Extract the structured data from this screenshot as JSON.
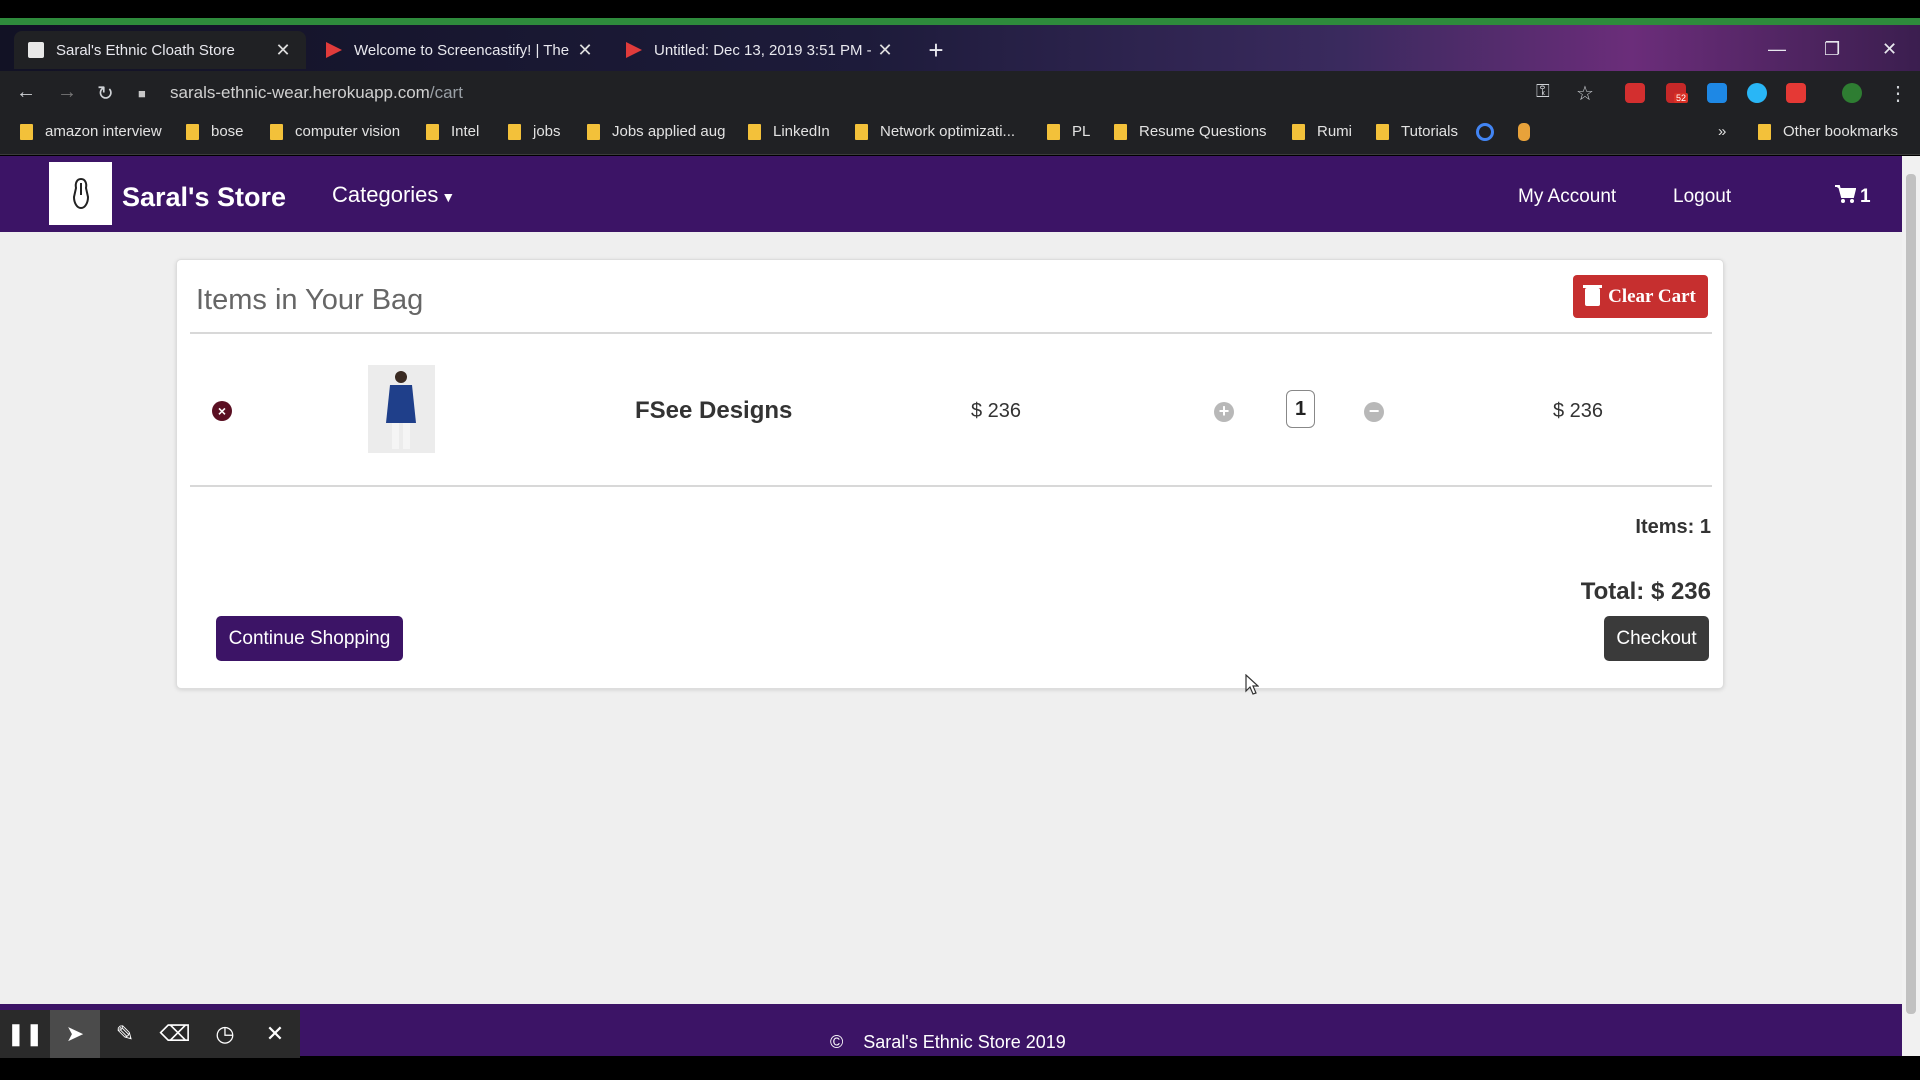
{
  "browser": {
    "tabs": [
      {
        "title": "Saral's Ethnic Cloath Store",
        "active": true
      },
      {
        "title": "Welcome to Screencastify! | The",
        "active": false
      },
      {
        "title": "Untitled: Dec 13, 2019 3:51 PM -",
        "active": false
      }
    ],
    "url_host": "sarals-ethnic-wear.herokuapp.com",
    "url_path": "/cart",
    "ext_badge": "52",
    "bookmarks": [
      "amazon interview",
      "bose",
      "computer vision",
      "Intel",
      "jobs",
      "Jobs applied aug",
      "LinkedIn",
      "Network optimizati...",
      "PL",
      "Resume Questions",
      "Rumi",
      "Tutorials"
    ],
    "more_bookmarks": "»",
    "other_bookmarks": "Other bookmarks"
  },
  "navbar": {
    "brand": "Saral's Store",
    "categories": "Categories",
    "my_account": "My Account",
    "logout": "Logout",
    "cart_count": "1"
  },
  "cart": {
    "title": "Items in Your Bag",
    "clear_label": "Clear Cart",
    "items": [
      {
        "name": "FSee Designs",
        "price": "$ 236",
        "quantity": "1",
        "line_total": "$ 236"
      }
    ],
    "items_count": "Items: 1",
    "total": "Total: $ 236",
    "continue_label": "Continue Shopping",
    "checkout_label": "Checkout"
  },
  "footer": {
    "text": "©    Saral's Ethnic Store 2019"
  },
  "colors": {
    "navbar": "#3c1466",
    "clear_button": "#c62f2f",
    "checkout_button": "#3a3a3a"
  }
}
